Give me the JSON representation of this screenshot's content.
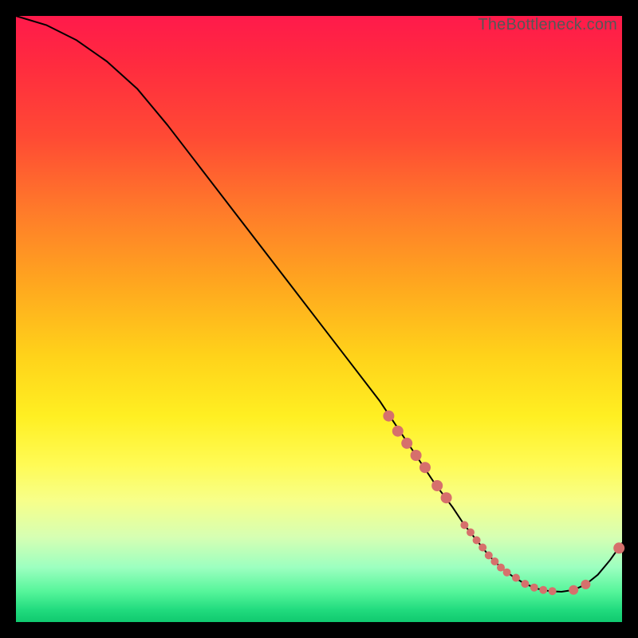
{
  "watermark": "TheBottleneck.com",
  "chart_data": {
    "type": "line",
    "title": "",
    "xlabel": "",
    "ylabel": "",
    "xlim": [
      0,
      100
    ],
    "ylim": [
      0,
      100
    ],
    "series": [
      {
        "name": "bottleneck-curve",
        "x": [
          0,
          5,
          10,
          15,
          20,
          25,
          30,
          35,
          40,
          45,
          50,
          55,
          60,
          63,
          66,
          69,
          72,
          74,
          76,
          78,
          80,
          82,
          84,
          86,
          88,
          90,
          92,
          94,
          96,
          98,
          100
        ],
        "y": [
          100,
          98.5,
          96,
          92.5,
          88,
          82,
          75.5,
          69,
          62.5,
          56,
          49.5,
          43,
          36.5,
          32,
          27.5,
          23,
          19,
          16,
          13.5,
          11,
          9,
          7.5,
          6.3,
          5.5,
          5.1,
          5,
          5.3,
          6.2,
          7.8,
          10.2,
          13
        ]
      }
    ],
    "markers": {
      "name": "highlighted-points",
      "x": [
        61.5,
        63,
        64.5,
        66,
        67.5,
        69.5,
        71,
        74,
        75,
        76,
        77,
        78,
        79,
        80,
        81,
        82.5,
        84,
        85.5,
        87,
        88.5,
        92,
        94,
        99.5
      ],
      "y": [
        34,
        31.5,
        29.5,
        27.5,
        25.5,
        22.5,
        20.5,
        16,
        14.8,
        13.5,
        12.3,
        11,
        10,
        9,
        8.2,
        7.3,
        6.3,
        5.7,
        5.3,
        5.1,
        5.3,
        6.2,
        12.2
      ],
      "size": [
        7,
        7,
        7,
        7,
        7,
        7,
        7,
        5,
        5,
        5,
        5,
        5,
        5,
        5,
        5,
        5,
        5,
        5,
        5,
        5,
        6,
        6,
        7
      ]
    },
    "gradient_stops": [
      {
        "pos": 0,
        "color": "#ff1a4b"
      },
      {
        "pos": 20,
        "color": "#ff4a34"
      },
      {
        "pos": 44,
        "color": "#ffa61f"
      },
      {
        "pos": 66,
        "color": "#ffef22"
      },
      {
        "pos": 86,
        "color": "#d6ffb3"
      },
      {
        "pos": 100,
        "color": "#10c96f"
      }
    ]
  }
}
